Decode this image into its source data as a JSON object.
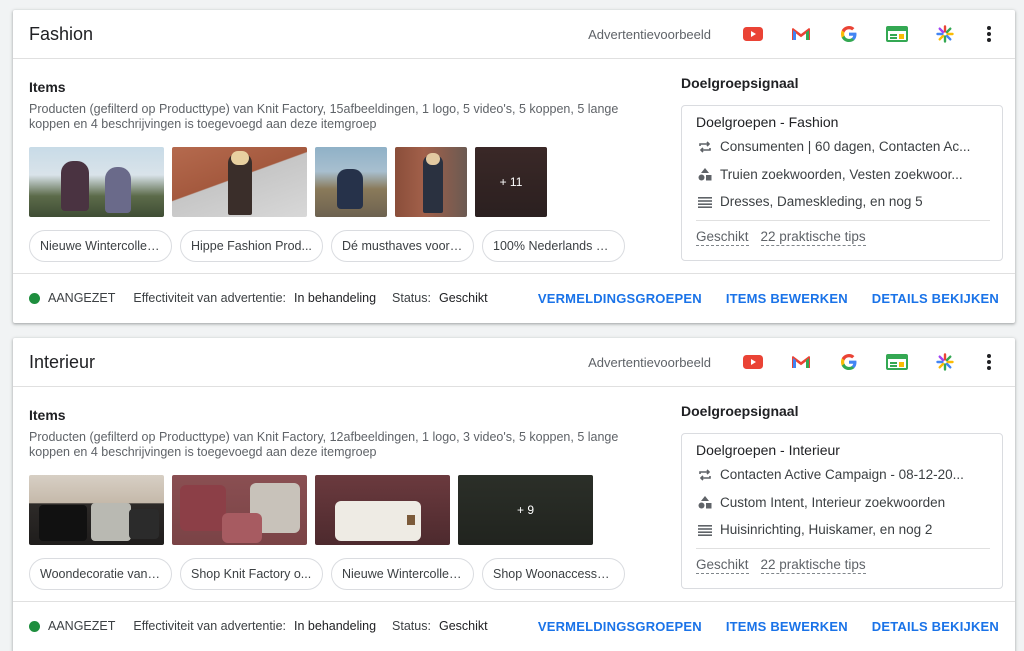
{
  "preview_label": "Advertentievoorbeeld",
  "channel_icons": [
    "youtube-icon",
    "gmail-icon",
    "google-icon",
    "display-icon",
    "discover-icon"
  ],
  "colors": {
    "accent": "#1a73e8",
    "status_on": "#1e8e3e",
    "youtube": "#ea4335",
    "display": "#34a853"
  },
  "groups": [
    {
      "title": "Fashion",
      "items_title": "Items",
      "description": "Producten (gefilterd op Producttype) van Knit Factory, 15afbeeldingen, 1 logo, 5 video's, 5 koppen, 5 lange koppen en 4 beschrijvingen is toegevoegd aan deze itemgroep",
      "more_count": "+ 11",
      "chips": [
        "Nieuwe Wintercollec...",
        "Hippe Fashion Prod...",
        "Dé musthaves voor ...",
        "100% Nederlands Br..."
      ],
      "signal_title": "Doelgroepsignaal",
      "signal_name": "Doelgroepen - Fashion",
      "signal_rows": [
        "Consumenten | 60 dagen, Contacten Ac...",
        "Truien zoekwoorden, Vesten zoekwoor...",
        "Dresses, Dameskleding, en nog 5"
      ],
      "signal_status": "Geschikt",
      "signal_tips": "22 praktische tips",
      "status": "AANGEZET",
      "effectiveness_label": "Effectiviteit van advertentie:",
      "effectiveness_value": "In behandeling",
      "status_label": "Status:",
      "status_value": "Geschikt",
      "actions": [
        "VERMELDINGSGROEPEN",
        "ITEMS BEWERKEN",
        "DETAILS BEKIJKEN"
      ]
    },
    {
      "title": "Interieur",
      "items_title": "Items",
      "description": "Producten (gefilterd op Producttype) van Knit Factory, 12afbeeldingen, 1 logo, 3 video's, 5 koppen, 5 lange koppen en 4 beschrijvingen is toegevoegd aan deze itemgroep",
      "more_count": "+ 9",
      "chips": [
        "Woondecoratie van ...",
        "Shop Knit Factory o...",
        "Nieuwe Wintercollec...",
        "Shop Woonaccessoi..."
      ],
      "signal_title": "Doelgroepsignaal",
      "signal_name": "Doelgroepen - Interieur",
      "signal_rows": [
        "Contacten Active Campaign - 08-12-20...",
        "Custom Intent, Interieur zoekwoorden",
        "Huisinrichting, Huiskamer, en nog 2"
      ],
      "signal_status": "Geschikt",
      "signal_tips": "22 praktische tips",
      "status": "AANGEZET",
      "effectiveness_label": "Effectiviteit van advertentie:",
      "effectiveness_value": "In behandeling",
      "status_label": "Status:",
      "status_value": "Geschikt",
      "actions": [
        "VERMELDINGSGROEPEN",
        "ITEMS BEWERKEN",
        "DETAILS BEKIJKEN"
      ]
    }
  ]
}
